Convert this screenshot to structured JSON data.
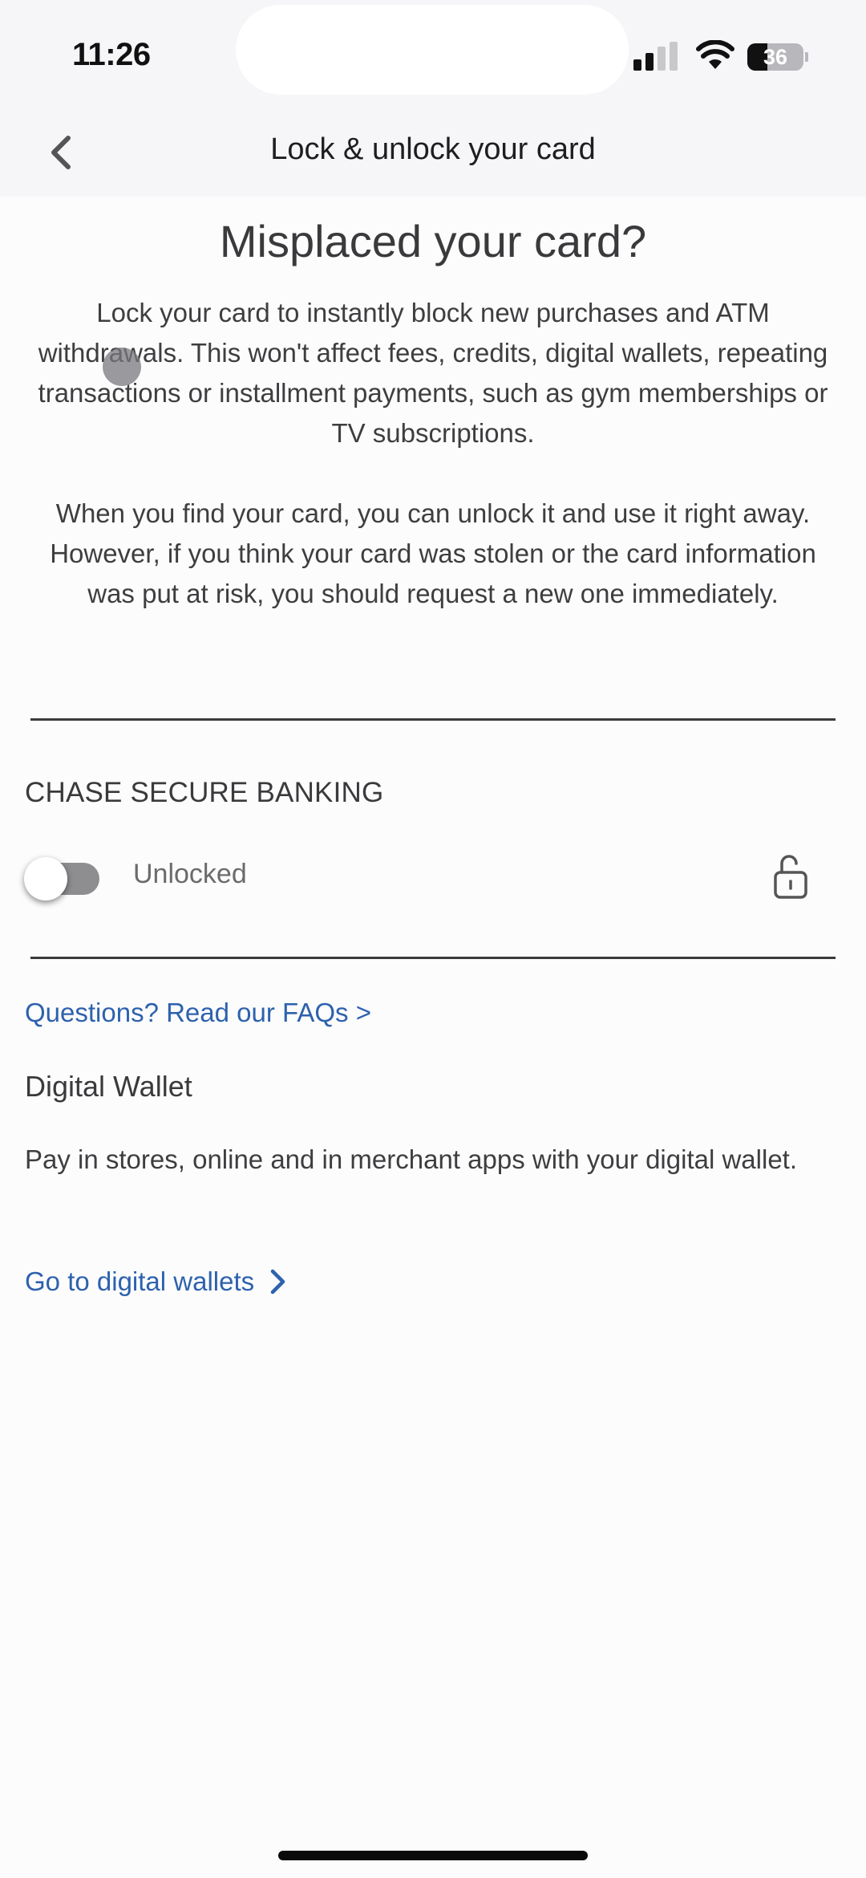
{
  "status_bar": {
    "time": "11:26",
    "signal_bars_active": 2,
    "signal_bars_total": 4,
    "wifi_icon": "wifi-icon",
    "battery_percent": 36,
    "battery_text": "36"
  },
  "header": {
    "back_icon": "chevron-left-icon",
    "title": "Lock & unlock your card"
  },
  "intro": {
    "heading": "Misplaced your card?",
    "paragraph_1": "Lock your card to instantly block new purchases and ATM withdrawals. This won't affect fees, credits, digital wallets, repeating transactions or installment payments, such as gym memberships or TV subscriptions.",
    "paragraph_2": "When you find your card, you can unlock it and use it right away. However, if you think your card was stolen or the card information was put at risk, you should request a new one immediately."
  },
  "card": {
    "account_name": "CHASE SECURE BANKING",
    "lock_toggle_on": false,
    "status_label": "Unlocked",
    "status_icon": "unlocked-padlock-icon"
  },
  "links": {
    "faq": "Questions? Read our FAQs >",
    "digital_wallets": "Go to digital wallets",
    "digital_wallets_icon": "chevron-right-icon"
  },
  "digital_wallet": {
    "heading": "Digital Wallet",
    "description": "Pay in stores, online and in merchant apps with your digital wallet."
  },
  "colors": {
    "link": "#2d62ad",
    "header_bg": "#f6f6f8",
    "page_bg": "#fdfcfd",
    "text": "#3e3e40",
    "toggle_off_track": "#8e8e90"
  }
}
